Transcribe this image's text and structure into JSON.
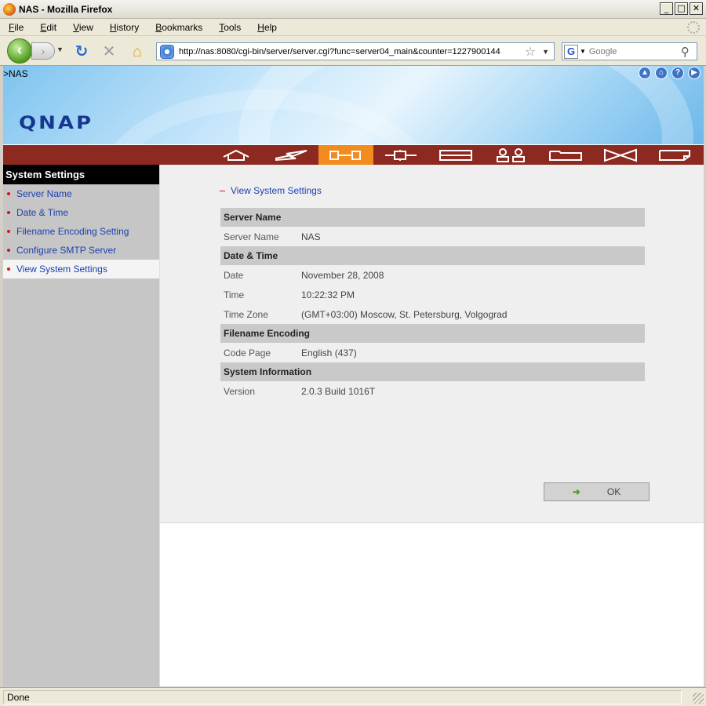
{
  "window": {
    "title": "NAS - Mozilla Firefox"
  },
  "menu": {
    "items": [
      {
        "u": "F",
        "rest": "ile"
      },
      {
        "u": "E",
        "rest": "dit"
      },
      {
        "u": "V",
        "rest": "iew"
      },
      {
        "u": "H",
        "rest": "istory"
      },
      {
        "u": "B",
        "rest": "ookmarks"
      },
      {
        "u": "T",
        "rest": "ools"
      },
      {
        "u": "H",
        "rest": "elp"
      }
    ]
  },
  "nav": {
    "url": "http://nas:8080/cgi-bin/server/server.cgi?func=server04_main&counter=1227900144",
    "search_placeholder": "Google",
    "search_engine_icon": "G"
  },
  "banner": {
    "breadcrumb": ">NAS",
    "logo": "QNAP",
    "top_icons": [
      "up-arrow-icon",
      "home-icon",
      "help-icon",
      "play-icon"
    ]
  },
  "tabs": [
    {
      "name": "home",
      "active": false
    },
    {
      "name": "quick-config",
      "active": false
    },
    {
      "name": "system-settings",
      "active": true
    },
    {
      "name": "network",
      "active": false
    },
    {
      "name": "device",
      "active": false
    },
    {
      "name": "users",
      "active": false
    },
    {
      "name": "shares",
      "active": false
    },
    {
      "name": "tools",
      "active": false
    },
    {
      "name": "logs",
      "active": false
    }
  ],
  "sidebar": {
    "header": "System Settings",
    "items": [
      {
        "label": "Server Name",
        "active": false
      },
      {
        "label": "Date & Time",
        "active": false
      },
      {
        "label": "Filename Encoding Setting",
        "active": false
      },
      {
        "label": "Configure SMTP Server",
        "active": false
      },
      {
        "label": "View System Settings",
        "active": true
      }
    ]
  },
  "main": {
    "heading": "View System Settings",
    "sections": [
      {
        "title": "Server Name",
        "rows": [
          {
            "key": "Server Name",
            "value": "NAS"
          }
        ]
      },
      {
        "title": "Date & Time",
        "rows": [
          {
            "key": "Date",
            "value": "November 28, 2008"
          },
          {
            "key": "Time",
            "value": "10:22:32 PM"
          },
          {
            "key": "Time Zone",
            "value": "(GMT+03:00) Moscow, St. Petersburg, Volgograd"
          }
        ]
      },
      {
        "title": "Filename Encoding",
        "rows": [
          {
            "key": "Code Page",
            "value": "English (437)"
          }
        ]
      },
      {
        "title": "System Information",
        "rows": [
          {
            "key": "Version",
            "value": "2.0.3 Build 1016T"
          }
        ]
      }
    ],
    "ok_label": "OK"
  },
  "status": {
    "text": "Done"
  },
  "colors": {
    "accent_orange": "#f28c1e",
    "nav_red": "#8c2a22",
    "link_blue": "#1a3fb0",
    "bullet_red": "#d8141a"
  }
}
